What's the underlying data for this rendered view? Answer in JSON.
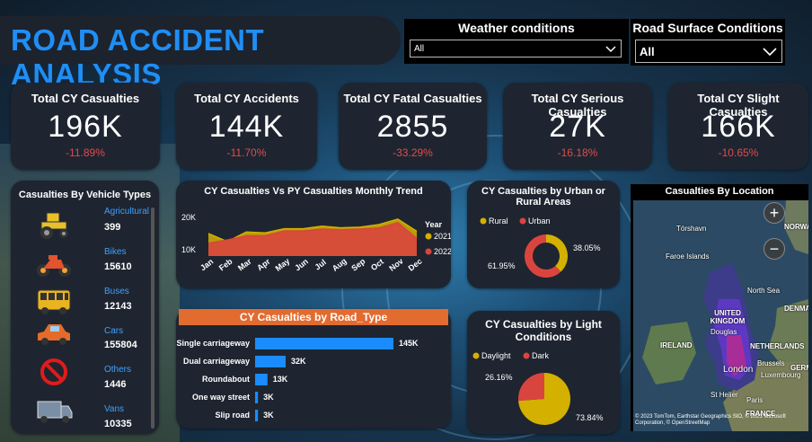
{
  "header": {
    "title": "ROAD ACCIDENT ANALYSIS"
  },
  "filters": {
    "weather": {
      "label": "Weather conditions",
      "value": "All"
    },
    "road_surface": {
      "label": "Road Surface Conditions",
      "value": "All"
    }
  },
  "kpis": [
    {
      "title": "Total CY Casualties",
      "value": "196K",
      "delta": "-11.89%"
    },
    {
      "title": "Total CY Accidents",
      "value": "144K",
      "delta": "-11.70%"
    },
    {
      "title": "Total CY Fatal Casualties",
      "value": "2855",
      "delta": "-33.29%"
    },
    {
      "title": "Total CY Serious Casualties",
      "value": "27K",
      "delta": "-16.18%"
    },
    {
      "title": "Total CY Slight Casualties",
      "value": "166K",
      "delta": "-10.65%"
    }
  ],
  "vehicles": {
    "title": "Casualties By Vehicle Types",
    "items": [
      {
        "name": "Agricultural",
        "value": "399",
        "icon": "tractor-icon"
      },
      {
        "name": "Bikes",
        "value": "15610",
        "icon": "motorbike-icon"
      },
      {
        "name": "Buses",
        "value": "12143",
        "icon": "bus-icon"
      },
      {
        "name": "Cars",
        "value": "155804",
        "icon": "car-icon"
      },
      {
        "name": "Others",
        "value": "1446",
        "icon": "prohibited-icon"
      },
      {
        "name": "Vans",
        "value": "10335",
        "icon": "van-icon"
      }
    ]
  },
  "trend_title": "CY Casualties Vs PY Casualties Monthly Trend",
  "urban_title": "CY Casualties by Urban or Rural Areas",
  "road_title": "CY Casualties by Road_Type",
  "light_title": "CY Casualties by Light Conditions",
  "location_title": "Casualties By Location",
  "map": {
    "labels": [
      "NORWAY",
      "Tórshavn",
      "Faroe Islands",
      "North Sea",
      "UNITED KINGDOM",
      "Douglas",
      "IRELAND",
      "NETHERLANDS",
      "DENMARK",
      "London",
      "Brussels",
      "Luxembourg",
      "GERM",
      "St Helier",
      "Paris",
      "FRANCE"
    ],
    "attribution": "© 2023 TomTom, Earthstar Geographics SIO, © 2023 Microsoft Corporation, © OpenStreetMap",
    "zoom_in": "+",
    "zoom_out": "−"
  },
  "chart_data": [
    {
      "type": "area",
      "title": "CY Casualties Vs PY Casualties Monthly Trend",
      "x": [
        "Jan",
        "Feb",
        "Mar",
        "Apr",
        "May",
        "Jun",
        "Jul",
        "Aug",
        "Sep",
        "Oct",
        "Nov",
        "Dec"
      ],
      "yticks": [
        "20K",
        "10K"
      ],
      "ylim": [
        8000,
        22000
      ],
      "legend_title": "Year",
      "series": [
        {
          "name": "2021",
          "color": "#d4b000",
          "values": [
            15000,
            12500,
            15500,
            15200,
            16500,
            16500,
            17300,
            16800,
            17000,
            17800,
            19500,
            15700
          ]
        },
        {
          "name": "2022",
          "color": "#d9453e",
          "values": [
            12000,
            13000,
            14300,
            14300,
            15800,
            15800,
            16400,
            16200,
            16400,
            16700,
            18400,
            13500
          ]
        }
      ]
    },
    {
      "type": "pie",
      "title": "CY Casualties by Urban or Rural Areas",
      "donut": true,
      "categories": [
        "Rural",
        "Urban"
      ],
      "values": [
        38.05,
        61.95
      ],
      "labels": [
        "38.05%",
        "61.95%"
      ],
      "colors": [
        "#d4b000",
        "#d9453e"
      ]
    },
    {
      "type": "bar",
      "title": "CY Casualties by Road_Type",
      "orientation": "horizontal",
      "categories": [
        "Single carriageway",
        "Dual carriageway",
        "Roundabout",
        "One way street",
        "Slip road"
      ],
      "values": [
        145,
        32,
        13,
        3,
        3
      ],
      "labels": [
        "145K",
        "32K",
        "13K",
        "3K",
        "3K"
      ],
      "xlim": [
        0,
        145
      ],
      "color": "#1a8cff"
    },
    {
      "type": "pie",
      "title": "CY Casualties by Light Conditions",
      "donut": false,
      "categories": [
        "Daylight",
        "Dark"
      ],
      "values": [
        73.84,
        26.16
      ],
      "labels": [
        "73.84%",
        "26.16%"
      ],
      "colors": [
        "#d4b000",
        "#d9453e"
      ]
    }
  ]
}
